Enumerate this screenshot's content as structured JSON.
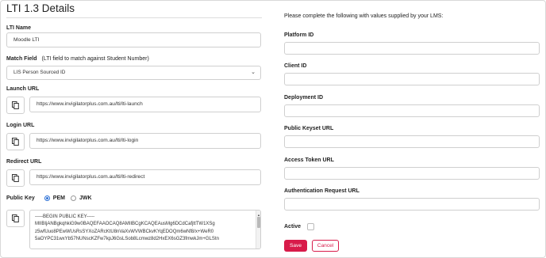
{
  "page": {
    "title": "LTI 1.3 Details",
    "instructions": "Please complete the following with values supplied by your LMS:"
  },
  "left": {
    "lti_name": {
      "label": "LTI Name",
      "value": "Moodle LTI"
    },
    "match_field": {
      "label": "Match Field",
      "hint": "(LTI field to match against Student Number)",
      "selected": "LIS Person Sourced ID"
    },
    "launch_url": {
      "label": "Launch URL",
      "value": "https://www.invigilatorplus.com.au/lti/lti-launch"
    },
    "login_url": {
      "label": "Login URL",
      "value": "https://www.invigilatorplus.com.au/lti/lti-login"
    },
    "redirect_url": {
      "label": "Redirect URL",
      "value": "https://www.invigilatorplus.com.au/lti/lti-redirect"
    },
    "public_key": {
      "label": "Public Key",
      "options": [
        "PEM",
        "JWK"
      ],
      "selected": "PEM",
      "lines": [
        "-----BEGIN PUBLIC KEY-----",
        "MIIBIjANBgkqhkiG9w0BAQEFAAOCAQ8AMIIBCgKCAQEAusMg6DCdCafjttTW1XSg",
        "z5wfUuo8PEwWUsRsSYXoZARcKtU8nVaXvWVWBCkvKYqEDOQm6wNf8/x+WeR0",
        "5aOYPC31wxYb57NUNscKZFw7kpJ6GsLSob8Lcmwz8d2HxEX6sGZ3fmwkJm+GLStn"
      ]
    }
  },
  "right": {
    "platform_id": {
      "label": "Platform ID",
      "value": ""
    },
    "client_id": {
      "label": "Client ID",
      "value": ""
    },
    "deployment_id": {
      "label": "Deployment ID",
      "value": ""
    },
    "public_keyset_url": {
      "label": "Public Keyset URL",
      "value": ""
    },
    "access_token_url": {
      "label": "Access Token URL",
      "value": ""
    },
    "auth_request_url": {
      "label": "Authentication Request URL",
      "value": ""
    },
    "active": {
      "label": "Active",
      "checked": false
    }
  },
  "buttons": {
    "save": "Save",
    "cancel": "Cancel"
  },
  "colors": {
    "primary": "#d81b4a",
    "radio_accent": "#2a6fd6"
  },
  "icons": {
    "copy": "copy-icon",
    "dropdown": "chevron-down-icon"
  }
}
